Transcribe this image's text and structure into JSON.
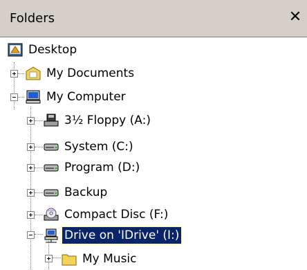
{
  "panel": {
    "title": "Folders",
    "close_glyph": "✕"
  },
  "tree": {
    "desktop": {
      "label": "Desktop",
      "icon": "desktop-icon"
    },
    "my_documents": {
      "label": "My Documents",
      "icon": "my-documents-folder-icon",
      "expander": "plus"
    },
    "my_computer": {
      "label": "My Computer",
      "icon": "my-computer-icon",
      "expander": "minus"
    },
    "drives": [
      {
        "label": "3½ Floppy (A:)",
        "icon": "floppy-drive-icon",
        "expander": "plus"
      },
      {
        "label": "System (C:)",
        "icon": "hard-drive-icon",
        "expander": "plus"
      },
      {
        "label": "Program (D:)",
        "icon": "hard-drive-icon",
        "expander": "plus"
      },
      {
        "label": "Backup",
        "icon": "hard-drive-icon",
        "expander": "plus"
      },
      {
        "label": "Compact Disc (F:)",
        "icon": "cd-drive-icon",
        "expander": "plus"
      },
      {
        "label": "Drive on 'IDrive' (I:)",
        "icon": "network-drive-icon",
        "expander": "minus",
        "selected": true
      }
    ],
    "my_music": {
      "label": "My Music",
      "icon": "folder-icon",
      "expander": "plus"
    }
  },
  "colors": {
    "selection": "#0a246a",
    "header_bg": "#d4d0c8"
  }
}
